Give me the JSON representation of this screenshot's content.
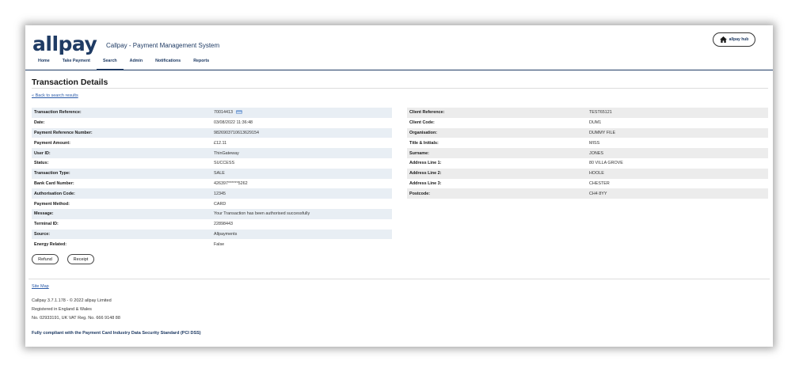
{
  "brand": {
    "logo": "allpay",
    "app_title": "Callpay - Payment Management System"
  },
  "nav": {
    "tabs": [
      {
        "label": "Home"
      },
      {
        "label": "Take Payment"
      },
      {
        "label": "Search",
        "active": true
      },
      {
        "label": "Admin"
      },
      {
        "label": "Notifications"
      },
      {
        "label": "Reports"
      }
    ]
  },
  "hub_button": {
    "label": "allpay hub",
    "icon": "home-icon"
  },
  "page": {
    "title": "Transaction Details",
    "back_link": "« Back to search results"
  },
  "transaction": [
    {
      "label": "Transaction Reference:",
      "value": "70014413"
    },
    {
      "label": "Date:",
      "value": "03/08/2022 11:36:48"
    },
    {
      "label": "Payment Reference Number:",
      "value": "9826903710613629154"
    },
    {
      "label": "Payment Amount:",
      "value": "£12.11"
    },
    {
      "label": "User ID:",
      "value": "ThinGateway"
    },
    {
      "label": "Status:",
      "value": "SUCCESS"
    },
    {
      "label": "Transaction Type:",
      "value": "SALE"
    },
    {
      "label": "Bank Card Number:",
      "value": "426397******5262"
    },
    {
      "label": "Authorisation Code:",
      "value": "12345"
    },
    {
      "label": "Payment Method:",
      "value": "CARD"
    },
    {
      "label": "Message:",
      "value": "Your Transaction has been authorised successfully"
    },
    {
      "label": "Terminal ID:",
      "value": "22898443"
    },
    {
      "label": "Source:",
      "value": "Allpayments"
    },
    {
      "label": "Energy Related:",
      "value": "False"
    }
  ],
  "client": [
    {
      "label": "Client Reference:",
      "value": "TEST65121"
    },
    {
      "label": "Client Code:",
      "value": "DUM1"
    },
    {
      "label": "Organisation:",
      "value": "DUMMY FILE"
    },
    {
      "label": "Title & Initials:",
      "value": "MISS"
    },
    {
      "label": "Surname:",
      "value": "JONES"
    },
    {
      "label": "Address Line 1:",
      "value": "80 VILLA GROVE"
    },
    {
      "label": "Address Line 2:",
      "value": "HOOLE"
    },
    {
      "label": "Address Line 3:",
      "value": "CHESTER"
    },
    {
      "label": "Postcode:",
      "value": "CH4 8YY"
    }
  ],
  "actions": {
    "refund": "Refund",
    "receipt": "Receipt"
  },
  "footer": {
    "site_map": "Site Map",
    "version": "Callpay 3.7.1.178 - © 2022 allpay Limited",
    "registered": "Registered in England & Wales",
    "company": "No. 02933191, UK VAT Reg. No. 666 9148 88",
    "pci": "Fully compliant with the Payment Card Industry Data Security Standard (PCI DSS)"
  },
  "colors": {
    "brand": "#1f3b64",
    "link": "#2a5aa8",
    "row_alt": "#e8eef4"
  }
}
